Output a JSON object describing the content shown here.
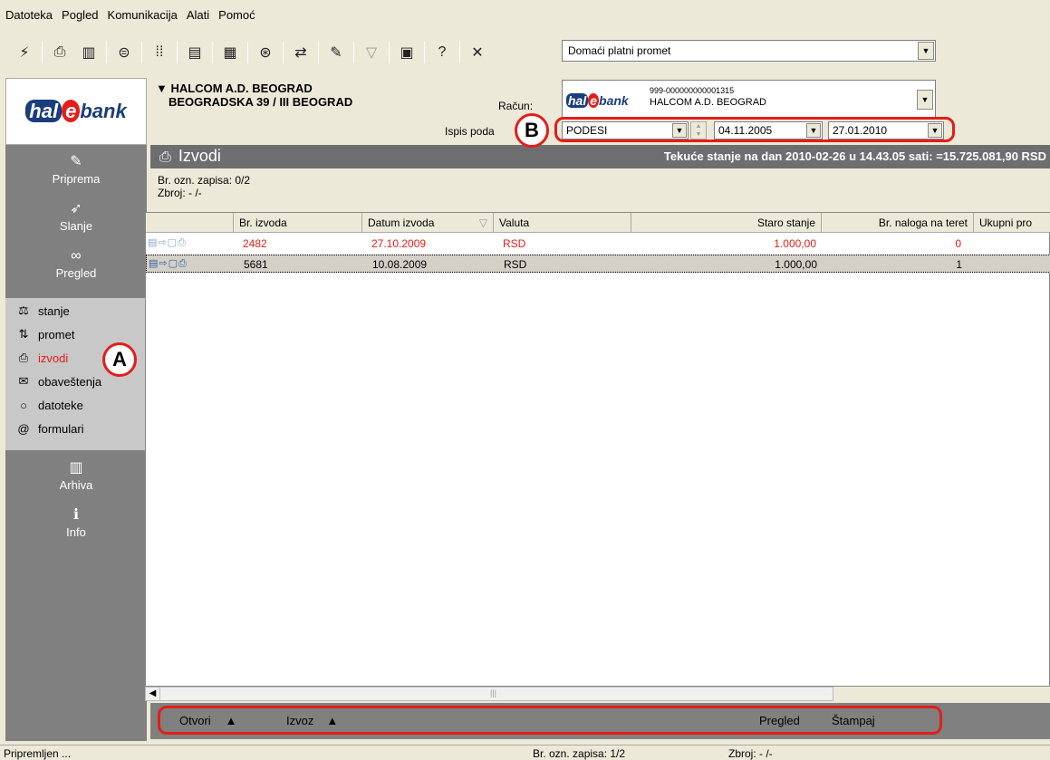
{
  "menubar": {
    "items": [
      "Datoteka",
      "Pogled",
      "Komunikacija",
      "Alati",
      "Pomoć"
    ]
  },
  "toolbar": {
    "icons": [
      "lightning-icon",
      "printer-icon",
      "book-icon",
      "coins-icon",
      "binary-icon",
      "accounts-icon",
      "calendar-icon",
      "exchange-icon",
      "transfer-icon",
      "edit-icon",
      "filter-icon",
      "calculator-icon",
      "help-icon",
      "tools-icon"
    ],
    "combo_value": "Domaći platni promet"
  },
  "sidebar": {
    "logo": {
      "hal": "hal",
      "e": "e",
      "bank": "bank"
    },
    "sections": [
      {
        "label": "Priprema",
        "icon": "edit-icon"
      },
      {
        "label": "Slanje",
        "icon": "send-icon"
      },
      {
        "label": "Pregled",
        "icon": "binoculars-icon"
      },
      {
        "label": "Arhiva",
        "icon": "archive-icon"
      },
      {
        "label": "Info",
        "icon": "info-icon"
      }
    ],
    "sub_items": [
      {
        "label": "stanje",
        "icon": "balance-icon"
      },
      {
        "label": "promet",
        "icon": "turnover-icon"
      },
      {
        "label": "izvodi",
        "icon": "printer-icon"
      },
      {
        "label": "obaveštenja",
        "icon": "envelope-icon"
      },
      {
        "label": "datoteke",
        "icon": "search-icon"
      },
      {
        "label": "formulari",
        "icon": "form-icon"
      }
    ]
  },
  "header": {
    "company_line1": "HALCOM A.D. BEOGRAD",
    "company_line2": "BEOGRADSKA 39 / III BEOGRAD",
    "racun_label": "Račun:",
    "racun_number": "999-000000000001315",
    "racun_name": "HALCOM A.D. BEOGRAD",
    "ispis_label": "Ispis poda",
    "preset": "PODESI",
    "date_from": "04.11.2005",
    "date_to": "27.01.2010"
  },
  "title": {
    "label": "Izvodi",
    "balance": "Tekuće stanje na dan 2010-02-26 u 14.43.05 sati: =15.725.081,90 RSD"
  },
  "info": {
    "marked": "Br. ozn. zapisa: 0/2",
    "sum": "Zbroj: - /-"
  },
  "table": {
    "columns": [
      "Br. izvoda",
      "Datum izvoda",
      "Valuta",
      "Staro stanje",
      "Br. naloga na teret",
      "Ukupni pro"
    ],
    "rows": [
      {
        "br": "2482",
        "datum": "27.10.2009",
        "valuta": "RSD",
        "staro": "1.000,00",
        "nalozi": "0"
      },
      {
        "br": "5681",
        "datum": "10.08.2009",
        "valuta": "RSD",
        "staro": "1.000,00",
        "nalozi": "1"
      }
    ]
  },
  "actions": {
    "otvori": "Otvori",
    "izvoz": "Izvoz",
    "pregled": "Pregled",
    "stampaj": "Štampaj"
  },
  "status": {
    "left": "Pripremljen ...",
    "marked": "Br. ozn. zapisa: 1/2",
    "sum": "Zbroj: - /-"
  },
  "annotations": {
    "a": "A",
    "b": "B"
  }
}
